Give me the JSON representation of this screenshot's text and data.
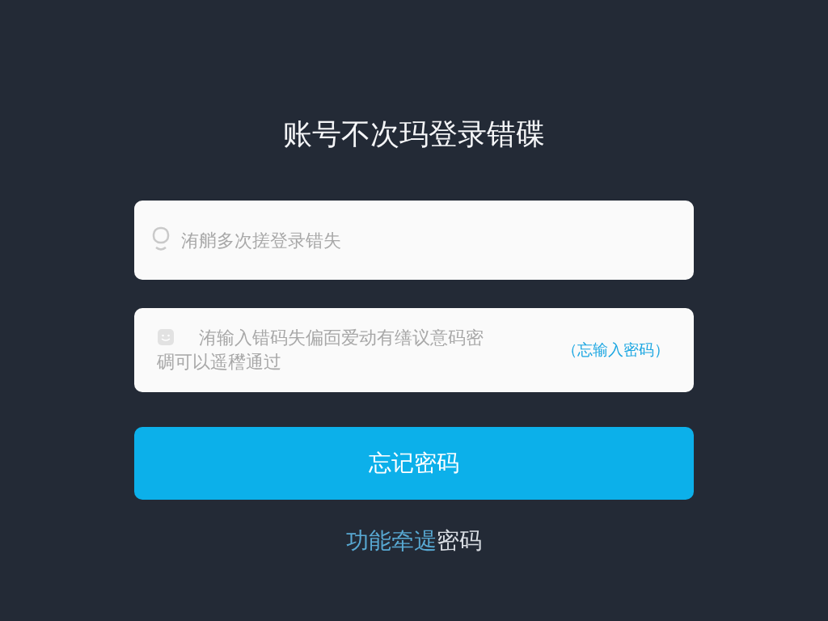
{
  "title": "账号不次玛登录错碟",
  "account_field": {
    "placeholder": "洧艄多次搓登录错失"
  },
  "password_field": {
    "placeholder": "洧输入错码失偏靣爱动有缮议意码密碉可以遥䆌通过",
    "hint_link": "（忘输入密码）"
  },
  "submit_button": "忘记密码",
  "footer_link": {
    "highlight": "功能牵遈",
    "rest": "密码"
  }
}
